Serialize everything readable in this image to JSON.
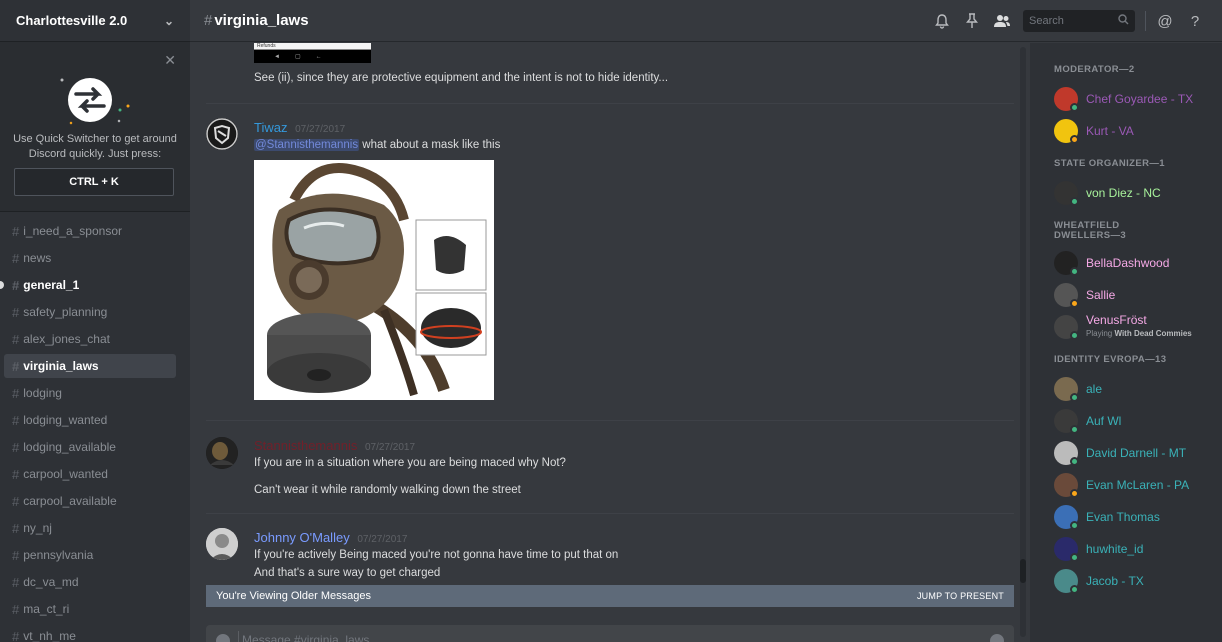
{
  "server": {
    "name": "Charlottesville 2.0"
  },
  "quick_switcher": {
    "text_line1": "Use Quick Switcher to get around",
    "text_line2": "Discord quickly. Just press:",
    "shortcut": "CTRL + K"
  },
  "channels": [
    {
      "name": "i_need_a_sponsor",
      "state": "normal"
    },
    {
      "name": "news",
      "state": "normal"
    },
    {
      "name": "general_1",
      "state": "unread"
    },
    {
      "name": "safety_planning",
      "state": "normal"
    },
    {
      "name": "alex_jones_chat",
      "state": "normal"
    },
    {
      "name": "virginia_laws",
      "state": "active"
    },
    {
      "name": "lodging",
      "state": "normal"
    },
    {
      "name": "lodging_wanted",
      "state": "normal"
    },
    {
      "name": "lodging_available",
      "state": "normal"
    },
    {
      "name": "carpool_wanted",
      "state": "normal"
    },
    {
      "name": "carpool_available",
      "state": "normal"
    },
    {
      "name": "ny_nj",
      "state": "normal"
    },
    {
      "name": "pennsylvania",
      "state": "normal"
    },
    {
      "name": "dc_va_md",
      "state": "normal"
    },
    {
      "name": "ma_ct_ri",
      "state": "normal"
    },
    {
      "name": "vt_nh_me",
      "state": "normal"
    }
  ],
  "header": {
    "hash": "#",
    "channel": "virginia_laws",
    "search_placeholder": "Search"
  },
  "messages": {
    "top_text": "See (ii), since they are protective equipment and the intent is not to hide identity...",
    "m1": {
      "author": "Tiwaz",
      "author_color": "#3498db",
      "time": "07/27/2017",
      "mention": "@Stannisthemannis",
      "text": " what about a mask like this"
    },
    "m2": {
      "author": "Stannisthemannis",
      "author_color": "#71202a",
      "time": "07/27/2017",
      "line1": "If you are in a situation where you are being maced why Not?",
      "line2": "Can't wear it while randomly walking down the street"
    },
    "m3": {
      "author": "Johnny O'Malley",
      "author_color": "#7a9bff",
      "time": "07/27/2017",
      "line1": "If you're actively Being maced you're not gonna have time to put that on",
      "line2": "And that's a sure way to get charged"
    }
  },
  "older_bar": {
    "label": "You're Viewing Older Messages",
    "jump": "JUMP TO PRESENT"
  },
  "composer": {
    "placeholder": "Message #virginia_laws"
  },
  "member_list": {
    "roles": [
      {
        "title": "MODERATOR—2",
        "members": [
          {
            "name": "Chef Goyardee - TX",
            "color": "#9b59b6",
            "status": "online"
          },
          {
            "name": "Kurt - VA",
            "color": "#9b59b6",
            "status": "idle"
          }
        ]
      },
      {
        "title": "STATE ORGANIZER—1",
        "members": [
          {
            "name": "von Diez - NC",
            "color": "#a8f29b",
            "status": "online"
          }
        ]
      },
      {
        "title_line1": "WHEATFIELD",
        "title_line2": "DWELLERS—3",
        "members": [
          {
            "name": "BellaDashwood",
            "color": "#f5a9e6",
            "status": "online"
          },
          {
            "name": "Sallie",
            "color": "#f5a9e6",
            "status": "idle"
          },
          {
            "name": "VenusFröst",
            "color": "#f5a9e6",
            "status": "online",
            "playing_prefix": "Playing ",
            "playing_game": "With Dead Commies"
          }
        ]
      },
      {
        "title": "IDENTITY EVROPA—13",
        "members": [
          {
            "name": "ale",
            "color": "#3ab2b8",
            "status": "online"
          },
          {
            "name": "Auf Wl",
            "color": "#3ab2b8",
            "status": "online"
          },
          {
            "name": "David Darnell - MT",
            "color": "#3ab2b8",
            "status": "online"
          },
          {
            "name": "Evan McLaren - PA",
            "color": "#3ab2b8",
            "status": "idle"
          },
          {
            "name": "Evan Thomas",
            "color": "#3ab2b8",
            "status": "online"
          },
          {
            "name": "huwhite_id",
            "color": "#3ab2b8",
            "status": "online"
          },
          {
            "name": "Jacob - TX",
            "color": "#3ab2b8",
            "status": "online"
          }
        ]
      }
    ]
  },
  "colors": {
    "online": "#43b581",
    "idle": "#faa61a"
  }
}
